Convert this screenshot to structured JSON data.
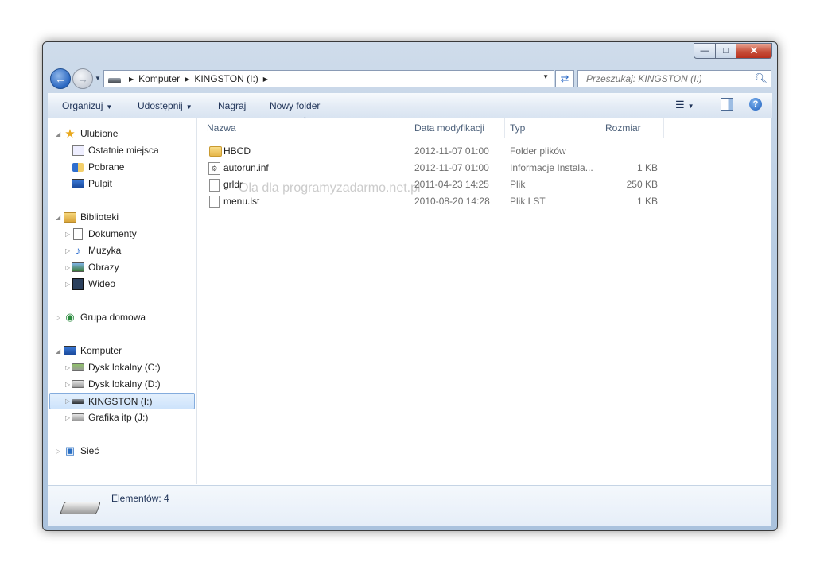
{
  "window": {
    "controls": {
      "minimize": "—",
      "maximize": "□",
      "close": "✕"
    }
  },
  "nav": {
    "breadcrumb": [
      "Komputer",
      "KINGSTON (I:)"
    ],
    "search_placeholder": "Przeszukaj: KINGSTON (I:)"
  },
  "toolbar": {
    "organize": "Organizuj",
    "share": "Udostępnij",
    "burn": "Nagraj",
    "new_folder": "Nowy folder"
  },
  "sidebar": {
    "favorites": {
      "label": "Ulubione",
      "items": [
        "Ostatnie miejsca",
        "Pobrane",
        "Pulpit"
      ]
    },
    "libraries": {
      "label": "Biblioteki",
      "items": [
        "Dokumenty",
        "Muzyka",
        "Obrazy",
        "Wideo"
      ]
    },
    "homegroup": {
      "label": "Grupa domowa"
    },
    "computer": {
      "label": "Komputer",
      "items": [
        "Dysk lokalny (C:)",
        "Dysk lokalny (D:)",
        "KINGSTON (I:)",
        "Grafika itp (J:)"
      ]
    },
    "network": {
      "label": "Sieć"
    }
  },
  "columns": {
    "name": "Nazwa",
    "modified": "Data modyfikacji",
    "type": "Typ",
    "size": "Rozmiar"
  },
  "files": [
    {
      "name": "HBCD",
      "modified": "2012-11-07 01:00",
      "type": "Folder plików",
      "size": ""
    },
    {
      "name": "autorun.inf",
      "modified": "2012-11-07 01:00",
      "type": "Informacje Instala...",
      "size": "1 KB"
    },
    {
      "name": "grldr",
      "modified": "2011-04-23 14:25",
      "type": "Plik",
      "size": "250 KB"
    },
    {
      "name": "menu.lst",
      "modified": "2010-08-20 14:28",
      "type": "Plik LST",
      "size": "1 KB"
    }
  ],
  "watermark": "Ola dla programyzadarmo.net.pl",
  "status": {
    "items_count": "Elementów: 4"
  }
}
